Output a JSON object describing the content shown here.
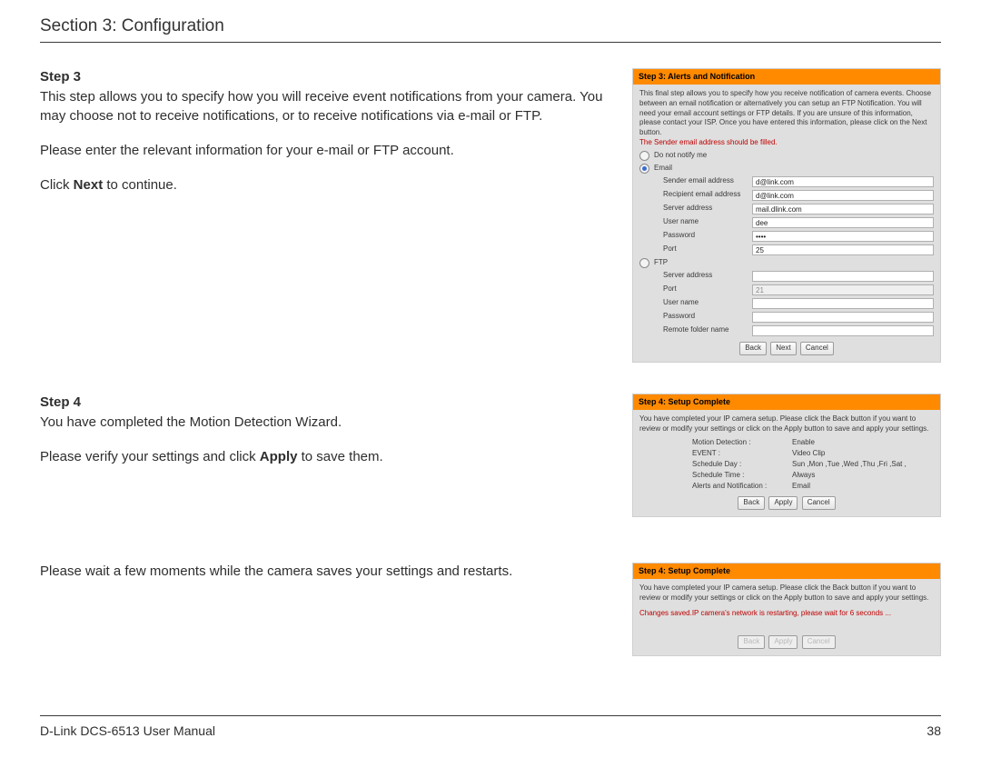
{
  "header": {
    "title": "Section 3: Configuration"
  },
  "footer": {
    "left": "D-Link DCS-6513 User Manual",
    "page": "38"
  },
  "step3": {
    "label": "Step 3",
    "p1a": "This step allows you to specify how you will receive event notifications from your camera. You may choose not to receive notifications, or to receive notifications via e-mail or FTP.",
    "p2": "Please enter the relevant information for your e-mail or FTP account.",
    "p3a": "Click ",
    "p3b": "Next",
    "p3c": " to continue."
  },
  "step4": {
    "label": "Step 4",
    "p1": "You have completed the Motion Detection Wizard.",
    "p2a": "Please verify your settings and click ",
    "p2b": "Apply",
    "p2c": " to save them.",
    "p3": "Please wait a few moments while the camera saves your settings and restarts."
  },
  "panel1": {
    "title": "Step 3: Alerts and Notification",
    "intro": "This final step allows you to specify how you receive notification of camera events. Choose between an email notification or alternatively you can setup an FTP Notification. You will need your email account settings or FTP details. If you are unsure of this information, please contact your ISP. Once you have entered this information, please click on the Next button.",
    "warn": "The Sender email address should be filled.",
    "opt_none": "Do not notify me",
    "opt_email": "Email",
    "opt_ftp": "FTP",
    "email": {
      "sender_label": "Sender email address",
      "sender_value": "d@link.com",
      "recipient_label": "Recipient email address",
      "recipient_value": "d@link.com",
      "server_label": "Server address",
      "server_value": "mail.dlink.com",
      "user_label": "User name",
      "user_value": "dee",
      "pass_label": "Password",
      "pass_value": "••••",
      "port_label": "Port",
      "port_value": "25"
    },
    "ftp": {
      "server_label": "Server address",
      "server_value": "",
      "port_label": "Port",
      "port_value": "21",
      "user_label": "User name",
      "user_value": "",
      "pass_label": "Password",
      "pass_value": "",
      "folder_label": "Remote folder name",
      "folder_value": ""
    },
    "btn_back": "Back",
    "btn_next": "Next",
    "btn_cancel": "Cancel"
  },
  "panel2": {
    "title": "Step 4: Setup Complete",
    "intro": "You have completed your IP camera setup. Please click the Back button if you want to review or modify your settings or click on the Apply button to save and apply your settings.",
    "rows": {
      "md_label": "Motion Detection :",
      "md_value": "Enable",
      "ev_label": "EVENT :",
      "ev_value": "Video Clip",
      "sd_label": "Schedule Day :",
      "sd_value": "Sun ,Mon ,Tue ,Wed ,Thu ,Fri ,Sat ,",
      "st_label": "Schedule Time :",
      "st_value": "Always",
      "an_label": "Alerts and Notification :",
      "an_value": "Email"
    },
    "btn_back": "Back",
    "btn_apply": "Apply",
    "btn_cancel": "Cancel"
  },
  "panel3": {
    "title": "Step 4: Setup Complete",
    "intro": "You have completed your IP camera setup. Please click the Back button if you want to review or modify your settings or click on the Apply button to save and apply your settings.",
    "msg": "Changes saved.IP camera's network is restarting, please wait for 6 seconds ...",
    "btn_back": "Back",
    "btn_apply": "Apply",
    "btn_cancel": "Cancel"
  }
}
